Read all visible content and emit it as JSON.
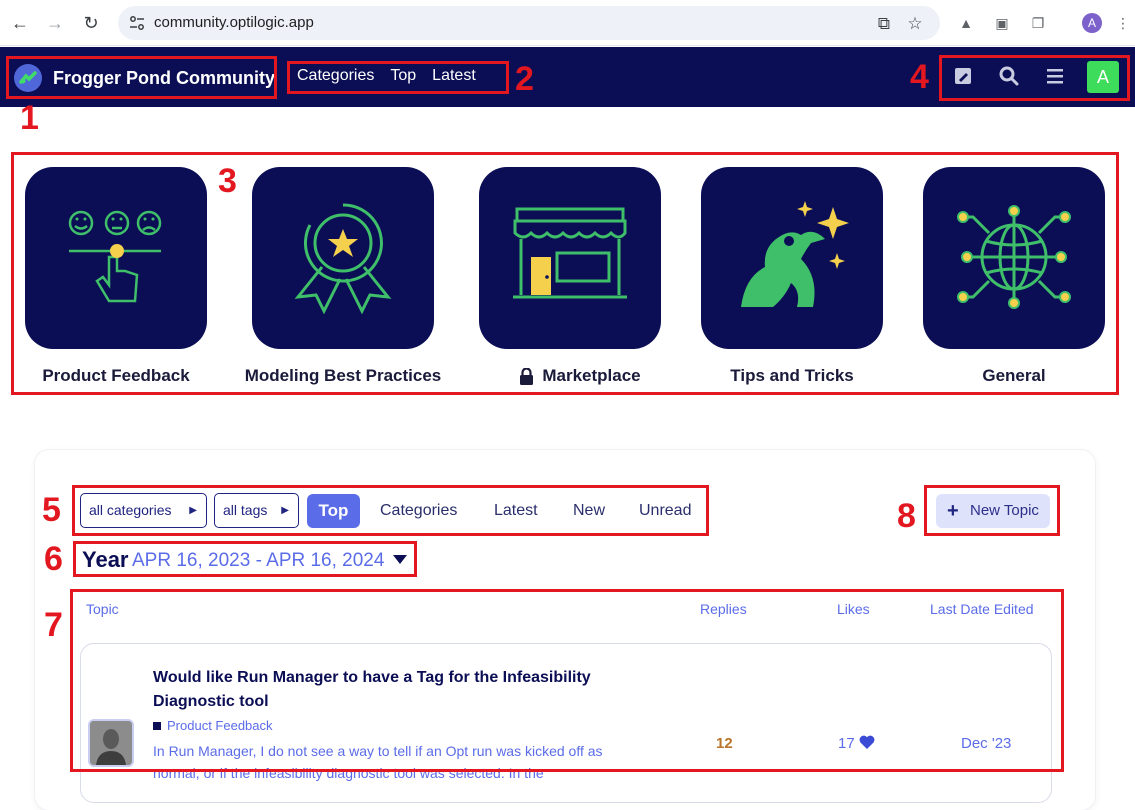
{
  "browser": {
    "url": "community.optilogic.app",
    "profile_initial": "A"
  },
  "header": {
    "brand": "Frogger Pond Community",
    "nav": [
      "Categories",
      "Top",
      "Latest"
    ],
    "user_initial": "A"
  },
  "categories": [
    {
      "label": "Product Feedback",
      "icon": "feedback-icon"
    },
    {
      "label": "Modeling Best Practices",
      "icon": "award-icon"
    },
    {
      "label": "Marketplace",
      "icon": "storefront-icon",
      "locked": true
    },
    {
      "label": "Tips and Tricks",
      "icon": "frog-sparkle-icon"
    },
    {
      "label": "General",
      "icon": "globe-network-icon"
    }
  ],
  "filters": {
    "category_dropdown": "all categories",
    "tag_dropdown": "all tags",
    "tabs": [
      "Top",
      "Categories",
      "Latest",
      "New",
      "Unread"
    ],
    "active_tab": "Top",
    "new_topic": "New Topic"
  },
  "period": {
    "label": "Year",
    "range": "APR 16, 2023 - APR 16, 2024"
  },
  "table": {
    "columns": [
      "Topic",
      "Replies",
      "Likes",
      "Last Date Edited"
    ],
    "rows": [
      {
        "title": "Would like Run Manager to have a Tag for the Infeasibility Diagnostic tool",
        "category": "Product Feedback",
        "excerpt": "In Run Manager, I do not see a way to tell if an Opt run was kicked off as normal, or if the infeasibility diagnostic tool was selected. In the",
        "replies": "12",
        "likes": "17",
        "date": "Dec '23"
      }
    ]
  },
  "annotations": [
    "1",
    "2",
    "3",
    "4",
    "5",
    "6",
    "7",
    "8"
  ],
  "colors": {
    "navy": "#0b0e55",
    "accent": "#5b6ce8",
    "annotation_red": "#e3171f",
    "icon_green": "#3fbf6a",
    "icon_yellow": "#f5d04c"
  }
}
